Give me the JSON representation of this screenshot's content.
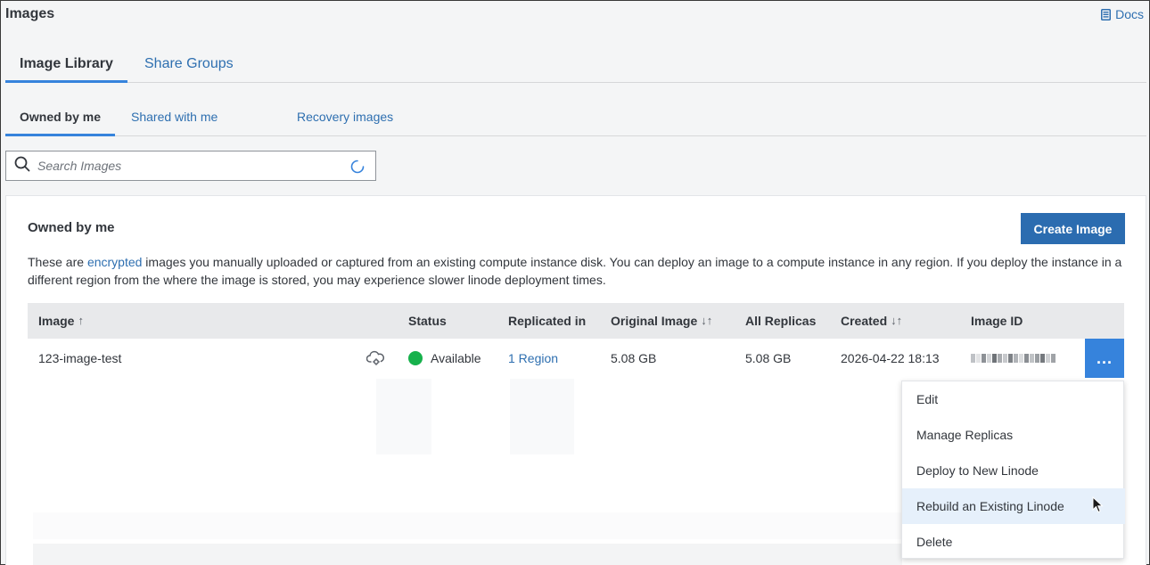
{
  "page": {
    "title": "Images",
    "docs_label": "Docs"
  },
  "tabs": [
    {
      "label": "Image Library",
      "active": true
    },
    {
      "label": "Share Groups",
      "active": false
    }
  ],
  "subtabs": [
    {
      "label": "Owned by me",
      "active": true
    },
    {
      "label": "Shared with me",
      "active": false
    },
    {
      "label": "Recovery images",
      "active": false
    }
  ],
  "search": {
    "placeholder": "Search Images",
    "value": ""
  },
  "section": {
    "title": "Owned by me",
    "create_button": "Create Image",
    "description_before": "These are ",
    "description_link": "encrypted",
    "description_after": " images you manually uploaded or captured from an existing compute instance disk. You can deploy an image to a compute instance in any region. If you deploy the instance in a different region from the where the image is stored, you may experience slower linode deployment times."
  },
  "table": {
    "columns": [
      {
        "label": "Image",
        "sort": "↑"
      },
      {
        "label": "Status",
        "sort": ""
      },
      {
        "label": "Replicated in",
        "sort": ""
      },
      {
        "label": "Original Image",
        "sort": "↓↑"
      },
      {
        "label": "All Replicas",
        "sort": ""
      },
      {
        "label": "Created",
        "sort": "↓↑"
      },
      {
        "label": "Image ID",
        "sort": ""
      }
    ],
    "rows": [
      {
        "name": "123-image-test",
        "status": "Available",
        "replicated_in": "1 Region",
        "original_size": "5.08 GB",
        "all_replicas": "5.08 GB",
        "created": "2026-04-22 18:13",
        "action_label": "..."
      }
    ]
  },
  "action_menu": {
    "items": [
      "Edit",
      "Manage Replicas",
      "Deploy to New Linode",
      "Rebuild an Existing Linode",
      "Delete"
    ],
    "hovered_index": 3
  },
  "colors": {
    "accent": "#3683dc",
    "link": "#2e6fb0",
    "primary_button": "#2b6cb0",
    "status_available": "#17b14c"
  },
  "icons": {
    "docs": "document-icon",
    "search": "search-icon",
    "loading": "spinner-icon",
    "cloud": "cloud-settings-icon",
    "cursor": "mouse-pointer-icon"
  }
}
